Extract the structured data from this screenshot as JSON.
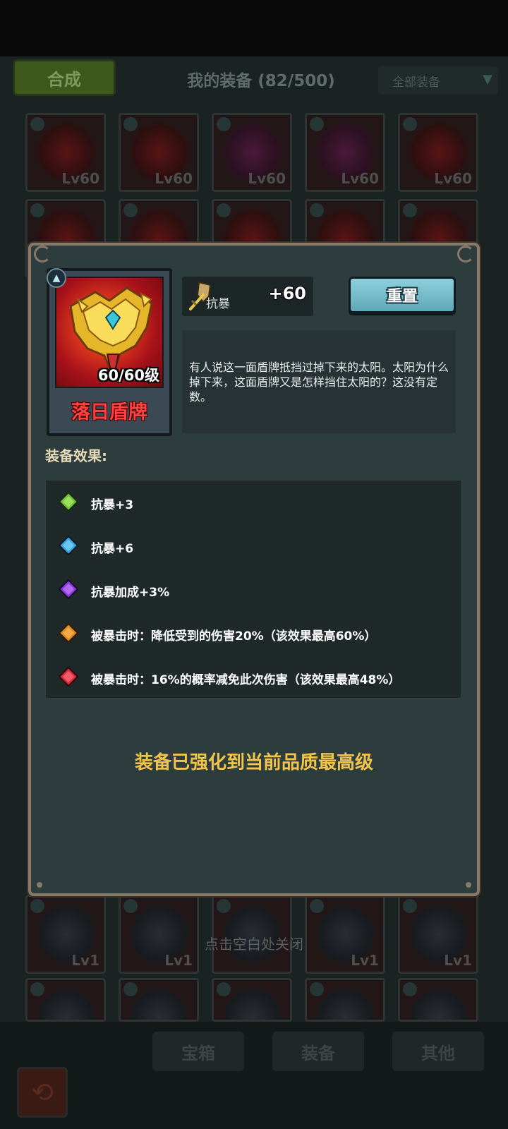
{
  "background": {
    "compose_label": "合成",
    "title": "我的装备 (82/500)",
    "filter": {
      "selected": "全部装备"
    },
    "grid_row1_levels": [
      "Lv60",
      "Lv60",
      "Lv60",
      "Lv60",
      "Lv60"
    ],
    "grid_row3_levels": [
      "Lv1",
      "Lv1",
      "",
      "Lv1",
      "Lv1"
    ],
    "close_hint": "点击空白处关闭",
    "bottom_tabs": [
      "宝箱",
      "装备",
      "其他"
    ]
  },
  "item": {
    "name": "落日盾牌",
    "level": "60/60级",
    "name_color": "#ff4040",
    "stat": {
      "icon": "shield-sword-icon",
      "label": "抗暴",
      "value": "+60"
    },
    "reset_label": "重置",
    "description": "有人说这一面盾牌抵挡过掉下来的太阳。太阳为什么掉下来，这面盾牌又是怎样挡住太阳的？这没有定数。"
  },
  "effects_title": "装备效果:",
  "effects": [
    {
      "gem": "green-gem-icon",
      "color": "#6cc23a",
      "text": "抗暴+3"
    },
    {
      "gem": "blue-gem-icon",
      "color": "#3aa6e0",
      "text": "抗暴+6"
    },
    {
      "gem": "purple-gem-icon",
      "color": "#8a3ae0",
      "text": "抗暴加成+3%"
    },
    {
      "gem": "orange-gem-icon",
      "color": "#e08a1e",
      "text": "被暴击时：降低受到的伤害20%（该效果最高60%）"
    },
    {
      "gem": "red-gem-icon",
      "color": "#e0283a",
      "text": "被暴击时：16%的概率减免此次伤害（该效果最高48%）"
    }
  ],
  "max_message": "装备已强化到当前品质最高级",
  "colors": {
    "accent_gold": "#f2c54a",
    "reset_button": "#8ed0dc",
    "panel": "#2d3d3d"
  }
}
